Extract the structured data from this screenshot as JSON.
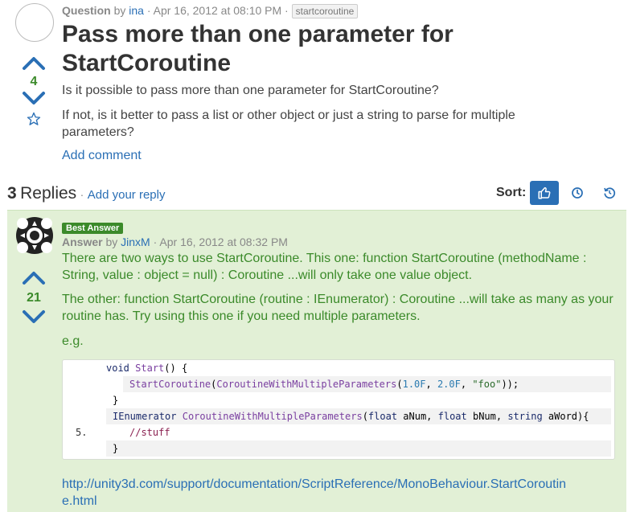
{
  "question": {
    "type_label": "Question",
    "by": "by",
    "author": "ina",
    "date": "· Apr 16, 2012 at 08:10 PM ·",
    "tag": "startcoroutine",
    "title": "Pass more than one parameter for StartCoroutine",
    "votes": "4",
    "paragraphs": [
      "Is it possible to pass more than one parameter for StartCoroutine?",
      "If not, is it better to pass a list or other object or just a string to parse for multiple parameters?"
    ],
    "add_comment": "Add comment"
  },
  "replies": {
    "count": "3",
    "label": "Replies",
    "separator": "·",
    "add_reply": "Add your reply",
    "sort_label": "Sort:"
  },
  "answer": {
    "badge": "Best Answer",
    "type_label": "Answer",
    "by": "by",
    "author": "JinxM",
    "date": "· Apr 16, 2012 at 08:32 PM",
    "votes": "21",
    "paragraphs": [
      "There are two ways to use StartCoroutine. This one: function StartCoroutine (methodName : String, value : object = null) : Coroutine ...will only take one value object.",
      "The other: function StartCoroutine (routine : IEnumerator) : Coroutine ...will take as many as your routine has. Try using this one if you need multiple parameters.",
      "e.g."
    ],
    "code": {
      "line_number_5": "5.",
      "l1_kw": "void",
      "l1_fn": "Start",
      "l1_rest": "() {",
      "l2_fn": "StartCoroutine",
      "l2_open": "(",
      "l2_fn2": "CoroutineWithMultipleParameters",
      "l2_open2": "(",
      "l2_n1": "1.0F",
      "l2_c1": ", ",
      "l2_n2": "2.0F",
      "l2_c2": ", ",
      "l2_s": "\"foo\"",
      "l2_close": "));",
      "l3": "}",
      "l4_kw": "IEnumerator",
      "l4_fn": "CoroutineWithMultipleParameters",
      "l4_p0": "(",
      "l4_kw1": "float",
      "l4_p1": " aNum, ",
      "l4_kw2": "float",
      "l4_p2": " bNum, ",
      "l4_kw3": "string",
      "l4_p3": " aWord){",
      "l5": "//stuff",
      "l6": "}"
    },
    "url_line1": "http://unity3d.com/support/documentation/ScriptReference/MonoBehaviour.StartCoroutin",
    "url_line2": "e.html"
  },
  "colors": {
    "accent": "#2a6fb5",
    "vote_green": "#3b8a2a",
    "answer_bg": "#e2f0d6"
  }
}
